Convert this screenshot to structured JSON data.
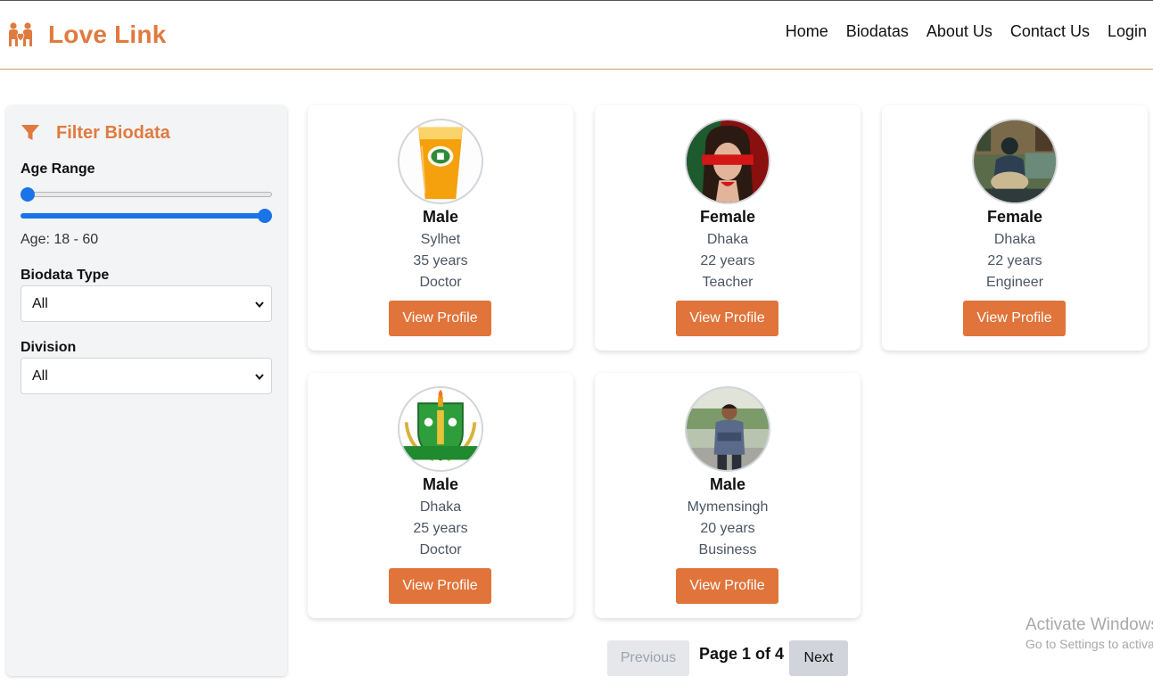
{
  "brand": {
    "name": "Love Link",
    "icon": "couple-heart-icon",
    "color": "#e07a3f"
  },
  "nav": {
    "links": [
      "Home",
      "Biodatas",
      "About Us",
      "Contact Us",
      "Login"
    ]
  },
  "filter": {
    "title": "Filter Biodata",
    "icon": "funnel-icon",
    "age_label": "Age Range",
    "age_min": 18,
    "age_max": 60,
    "age_text": "Age: 18 - 60",
    "type_label": "Biodata Type",
    "type_value": "All",
    "division_label": "Division",
    "division_value": "All"
  },
  "cards": [
    {
      "gender": "Male",
      "division": "Sylhet",
      "age": "35 years",
      "occupation": "Doctor",
      "button": "View Profile",
      "photo": "orange-juice-cup"
    },
    {
      "gender": "Female",
      "division": "Dhaka",
      "age": "22 years",
      "occupation": "Teacher",
      "button": "View Profile",
      "photo": "woman-red-ribbon"
    },
    {
      "gender": "Female",
      "division": "Dhaka",
      "age": "22 years",
      "occupation": "Engineer",
      "button": "View Profile",
      "photo": "woman-in-cafe"
    },
    {
      "gender": "Male",
      "division": "Dhaka",
      "age": "25 years",
      "occupation": "Doctor",
      "button": "View Profile",
      "photo": "green-university-logo",
      "logo_text": "Green University"
    },
    {
      "gender": "Male",
      "division": "Mymensingh",
      "age": "20 years",
      "occupation": "Business",
      "button": "View Profile",
      "photo": "man-standing-outdoors"
    }
  ],
  "pagination": {
    "previous": "Previous",
    "page_text": "Page 1 of 4",
    "next": "Next"
  },
  "watermark": {
    "line1": "Activate Windows",
    "line2": "Go to Settings to activate Windows."
  },
  "colors": {
    "accent": "#e0743a",
    "slider": "#1a73e8",
    "sidebar_bg": "#f3f4f6"
  }
}
